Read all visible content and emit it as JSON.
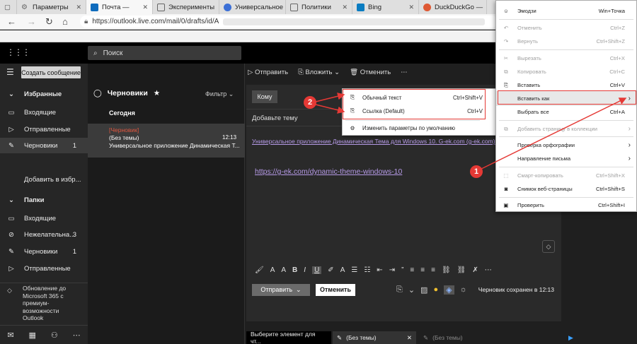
{
  "browser": {
    "tabs": [
      {
        "label": "Параметры",
        "fav_color": "#777777"
      },
      {
        "label": "Почта —",
        "fav_color": "#0f6cbd"
      },
      {
        "label": "Эксперименты",
        "fav_color": "#777777"
      },
      {
        "label": "Универсальное",
        "fav_color": "#3b6fd6"
      },
      {
        "label": "Политики",
        "fav_color": "#777777"
      },
      {
        "label": "Bing",
        "fav_color": "#0a7cc1"
      },
      {
        "label": "DuckDuckGo —",
        "fav_color": "#de5833"
      }
    ],
    "url": "https://outlook.live.com/mail/0/drafts/id/A"
  },
  "appbar": {
    "search_placeholder": "Поиск"
  },
  "leftnav": {
    "compose_label": "Создать сообщение",
    "favorites_header": "Избранные",
    "favorites": [
      {
        "label": "Входящие",
        "count": ""
      },
      {
        "label": "Отправленные",
        "count": ""
      },
      {
        "label": "Черновики",
        "count": "1"
      }
    ],
    "add_favorite": "Добавить в избр...",
    "folders_header": "Папки",
    "folders": [
      {
        "label": "Входящие",
        "count": ""
      },
      {
        "label": "Нежелательна...",
        "count": "3"
      },
      {
        "label": "Черновики",
        "count": "1"
      },
      {
        "label": "Отправленные",
        "count": ""
      }
    ],
    "upgrade_text": [
      "Обновление до",
      "Microsoft 365 с",
      "премиум-",
      "возможности",
      "Outlook"
    ]
  },
  "msglist": {
    "title": "Черновики",
    "filter": "Фильтр",
    "group": "Сегодня",
    "message": {
      "draft_tag": "[Черновик]",
      "subject": "(Без темы)",
      "time": "12:13",
      "preview": "Универсальное приложение Динамическая Т..."
    }
  },
  "compose": {
    "toolbar": {
      "send": "Отправить",
      "attach": "Вложить",
      "discard": "Отменить"
    },
    "to_label": "Кому",
    "subject_placeholder": "Добавьте тему",
    "link1": "Универсальное приложение Динамическая Тема для Windows 10. G-ek.com (g-ek.com)",
    "link2": "https://g-ek.com/dynamic-theme-windows-10",
    "send_button": "Отправить",
    "discard_button": "Отменить",
    "saved_status": "Черновик сохранен в 12:13"
  },
  "bottom_tabs": [
    {
      "label": "Выберите элемент для чт..."
    },
    {
      "label": "(Без темы)"
    },
    {
      "label": "(Без темы)"
    }
  ],
  "submenu": {
    "items": [
      {
        "label": "Обычный текст",
        "shortcut": "Ctrl+Shift+V",
        "icon": "clipboard-text-icon"
      },
      {
        "label": "Ссылка (Default)",
        "shortcut": "Ctrl+V",
        "icon": "clipboard-link-icon"
      },
      {
        "label": "Изменить параметры по умолчанию",
        "shortcut": "",
        "icon": "gear-icon"
      }
    ]
  },
  "context_menu": {
    "items": [
      {
        "label": "Эмодзи",
        "shortcut": "Win+Точка",
        "disabled": false
      },
      {
        "label": "Отменить",
        "shortcut": "Ctrl+Z",
        "disabled": true
      },
      {
        "label": "Вернуть",
        "shortcut": "Ctrl+Shift+Z",
        "disabled": true
      },
      {
        "label": "Вырезать",
        "shortcut": "Ctrl+X",
        "disabled": true
      },
      {
        "label": "Копировать",
        "shortcut": "Ctrl+C",
        "disabled": true
      },
      {
        "label": "Вставить",
        "shortcut": "Ctrl+V",
        "disabled": false
      },
      {
        "label": "Вставить как",
        "shortcut": "",
        "disabled": false
      },
      {
        "label": "Выбрать все",
        "shortcut": "Ctrl+A",
        "disabled": false
      },
      {
        "label": "Добавить страницу в коллекции",
        "shortcut": "",
        "disabled": true
      },
      {
        "label": "Проверка орфографии",
        "shortcut": "",
        "disabled": false
      },
      {
        "label": "Направление письма",
        "shortcut": "",
        "disabled": false
      },
      {
        "label": "Смарт-копировать",
        "shortcut": "Ctrl+Shift+X",
        "disabled": true
      },
      {
        "label": "Снимок веб-страницы",
        "shortcut": "Ctrl+Shift+S",
        "disabled": false
      },
      {
        "label": "Проверить",
        "shortcut": "Ctrl+Shift+I",
        "disabled": false
      }
    ]
  },
  "annotations": {
    "badge1": "1",
    "badge2": "2",
    "accent": "#e53935"
  }
}
